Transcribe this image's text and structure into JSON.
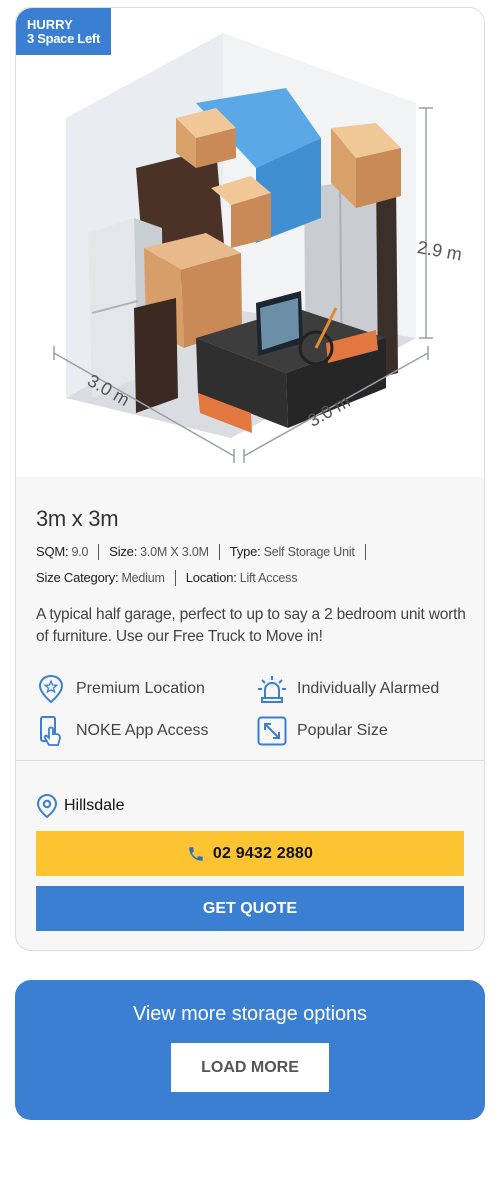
{
  "badge": {
    "line1": "HURRY",
    "line2": "3 Space Left"
  },
  "dimensions": {
    "width_label": "3.0 m",
    "depth_label": "3.0 m",
    "height_label": "2.9 m"
  },
  "unit": {
    "title": "3m x 3m",
    "meta": [
      {
        "label": "SQM:",
        "value": "9.0"
      },
      {
        "label": "Size:",
        "value": "3.0M X 3.0M"
      },
      {
        "label": "Type:",
        "value": "Self Storage Unit"
      },
      {
        "label": "Size Category:",
        "value": "Medium"
      },
      {
        "label": "Location:",
        "value": "Lift Access"
      }
    ],
    "description": "A typical half garage, perfect to up to say a 2 bedroom unit worth of furniture. Use our Free Truck to Move in!"
  },
  "features": [
    {
      "label": "Premium Location",
      "icon": "map-pin-star-icon"
    },
    {
      "label": "Individually Alarmed",
      "icon": "alarm-siren-icon"
    },
    {
      "label": "NOKE App Access",
      "icon": "phone-tap-icon"
    },
    {
      "label": "Popular Size",
      "icon": "resize-arrows-icon"
    }
  ],
  "location": {
    "name": "Hillsdale"
  },
  "actions": {
    "phone": "02 9432 2880",
    "quote": "GET QUOTE"
  },
  "more": {
    "title": "View more storage options",
    "button": "LOAD MORE"
  },
  "colors": {
    "accent_blue": "#3a7fd1",
    "accent_yellow": "#fcc431"
  }
}
